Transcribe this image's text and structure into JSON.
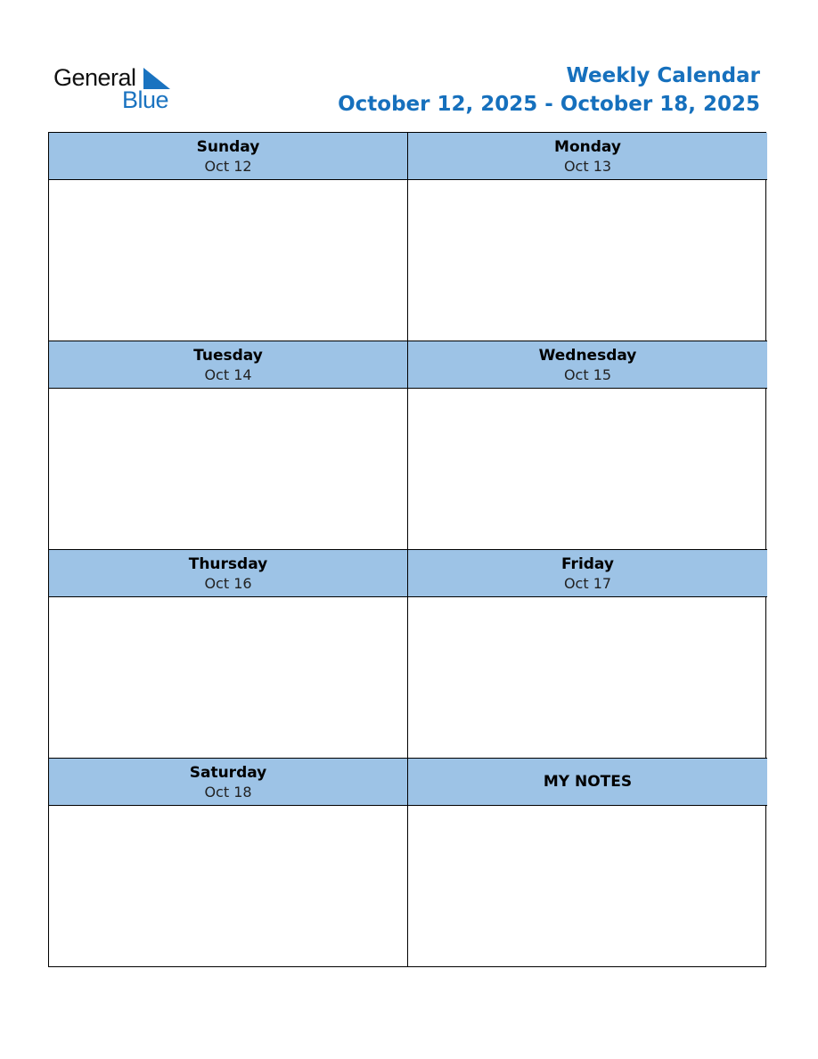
{
  "logo": {
    "word1": "General",
    "word2": "Blue"
  },
  "header": {
    "title": "Weekly Calendar",
    "range": "October 12, 2025 - October 18, 2025"
  },
  "colors": {
    "accent": "#1670bd",
    "header_fill": "#9dc3e6"
  },
  "days": [
    {
      "name": "Sunday",
      "date": "Oct 12"
    },
    {
      "name": "Monday",
      "date": "Oct 13"
    },
    {
      "name": "Tuesday",
      "date": "Oct 14"
    },
    {
      "name": "Wednesday",
      "date": "Oct 15"
    },
    {
      "name": "Thursday",
      "date": "Oct 16"
    },
    {
      "name": "Friday",
      "date": "Oct 17"
    },
    {
      "name": "Saturday",
      "date": "Oct 18"
    }
  ],
  "notes": {
    "label": "MY NOTES"
  }
}
